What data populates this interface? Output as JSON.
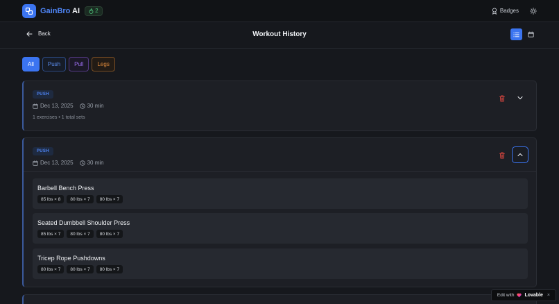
{
  "header": {
    "brand_main": "GainBro",
    "brand_suffix": " AI",
    "streak_count": "2",
    "badges_label": "Badges"
  },
  "subheader": {
    "back_label": "Back",
    "title": "Workout History"
  },
  "filters": [
    {
      "label": "All"
    },
    {
      "label": "Push"
    },
    {
      "label": "Pull"
    },
    {
      "label": "Legs"
    }
  ],
  "workouts": [
    {
      "tag": "PUSH",
      "date": "Dec 13, 2025",
      "duration": "30 min",
      "summary": "1 exercises • 1 total sets",
      "expanded": false
    },
    {
      "tag": "PUSH",
      "date": "Dec 13, 2025",
      "duration": "30 min",
      "expanded": true,
      "exercises": [
        {
          "name": "Barbell Bench Press",
          "sets": [
            "85 lbs × 8",
            "80 lbs × 7",
            "80 lbs × 7"
          ]
        },
        {
          "name": "Seated Dumbbell Shoulder Press",
          "sets": [
            "85 lbs × 7",
            "80 lbs × 7",
            "80 lbs × 7"
          ]
        },
        {
          "name": "Tricep Rope Pushdowns",
          "sets": [
            "80 lbs × 7",
            "80 lbs × 7",
            "80 lbs × 7"
          ]
        }
      ]
    }
  ],
  "lovable": {
    "prefix": "Edit with",
    "brand": "Lovable",
    "close": "×"
  },
  "colors": {
    "accent": "#3b74f0",
    "push": "#4f86f7",
    "pull": "#9c6ef0",
    "legs": "#e08b3c",
    "danger": "#d9463f"
  }
}
